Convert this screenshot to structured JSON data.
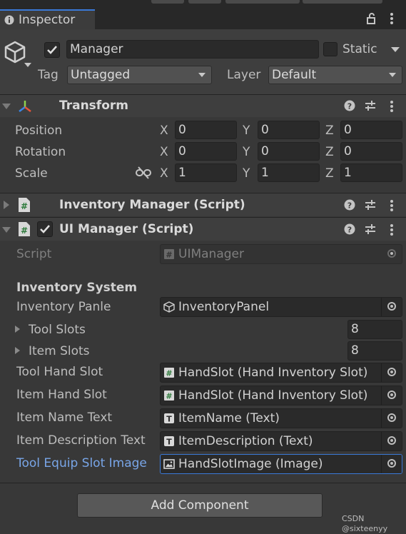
{
  "tab": {
    "title": "Inspector"
  },
  "gameobject": {
    "name": "Manager",
    "static_label": "Static",
    "tag_label": "Tag",
    "tag_value": "Untagged",
    "layer_label": "Layer",
    "layer_value": "Default"
  },
  "transform": {
    "title": "Transform",
    "rows": [
      {
        "label": "Position",
        "x": "0",
        "y": "0",
        "z": "0"
      },
      {
        "label": "Rotation",
        "x": "0",
        "y": "0",
        "z": "0"
      },
      {
        "label": "Scale",
        "x": "1",
        "y": "1",
        "z": "1"
      }
    ],
    "axes": {
      "x": "X",
      "y": "Y",
      "z": "Z"
    }
  },
  "inventory_manager": {
    "title": "Inventory Manager (Script)"
  },
  "ui_manager": {
    "title": "UI Manager (Script)",
    "script_label": "Script",
    "script_value": "UIManager",
    "section_header": "Inventory System",
    "fields": {
      "inventory_panle": {
        "label": "Inventory Panle",
        "value": "InventoryPanel"
      },
      "tool_slots": {
        "label": "Tool Slots",
        "value": "8"
      },
      "item_slots": {
        "label": "Item Slots",
        "value": "8"
      },
      "tool_hand_slot": {
        "label": "Tool Hand Slot",
        "value": "HandSlot (Hand Inventory Slot)"
      },
      "item_hand_slot": {
        "label": "Item Hand Slot",
        "value": "HandSlot (Hand Inventory Slot)"
      },
      "item_name_text": {
        "label": "Item Name Text",
        "value": "ItemName (Text)"
      },
      "item_description_text": {
        "label": "Item Description Text",
        "value": "ItemDescription (Text)"
      },
      "tool_equip_slot_image": {
        "label": "Tool Equip Slot Image",
        "value": "HandSlotImage (Image)"
      }
    }
  },
  "add_component": {
    "label": "Add Component"
  },
  "watermark": "CSDN @sixteenyy",
  "colors": {
    "panel_bg": "#383838",
    "header_bg": "#3e3e3e",
    "field_bg": "#2a2a2a",
    "highlight": "#79a6e8",
    "selected_border": "#3a79d8"
  }
}
